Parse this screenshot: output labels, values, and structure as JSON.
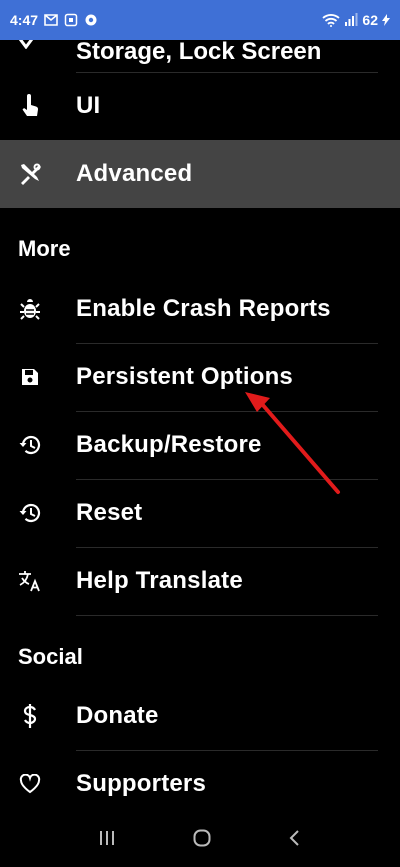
{
  "status_bar": {
    "time": "4:47",
    "battery": "62"
  },
  "partial_item": {
    "label": "Storage, Lock Screen"
  },
  "items_top": [
    {
      "label": "UI",
      "icon": "touch-icon"
    },
    {
      "label": "Advanced",
      "icon": "tools-icon"
    }
  ],
  "sections": {
    "more": "More",
    "social": "Social"
  },
  "more_items": [
    {
      "label": "Enable Crash Reports",
      "icon": "bug-icon"
    },
    {
      "label": "Persistent Options",
      "icon": "save-icon"
    },
    {
      "label": "Backup/Restore",
      "icon": "history-icon"
    },
    {
      "label": "Reset",
      "icon": "history-icon"
    },
    {
      "label": "Help Translate",
      "icon": "translate-icon"
    }
  ],
  "social_items": [
    {
      "label": "Donate",
      "icon": "dollar-icon"
    },
    {
      "label": "Supporters",
      "icon": "heart-icon"
    }
  ],
  "colors": {
    "status_bar": "#3f70d6",
    "active_row": "#444444",
    "annotation_arrow": "#e11b1b"
  }
}
